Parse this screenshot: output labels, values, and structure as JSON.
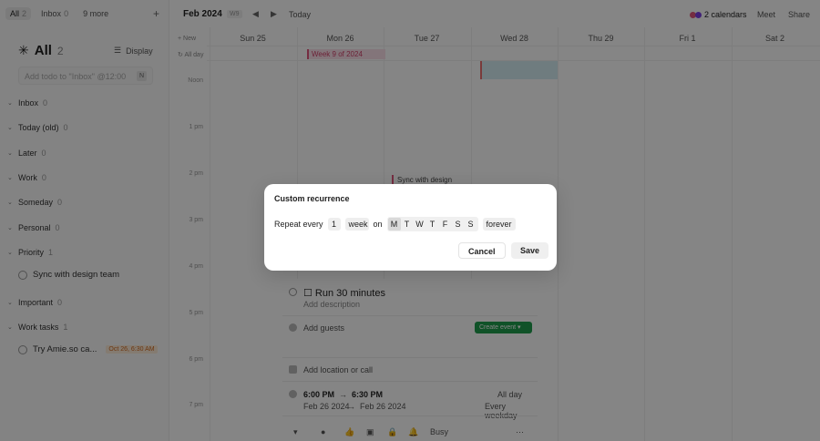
{
  "sidebar": {
    "tabs": [
      {
        "label": "All",
        "count": "2"
      },
      {
        "label": "Inbox",
        "count": "0"
      },
      {
        "label": "9 more",
        "count": ""
      }
    ],
    "header": {
      "title": "All",
      "count": "2",
      "display_label": "Display"
    },
    "add_placeholder": "Add todo to \"Inbox\" @12:00",
    "add_shortcut": "N",
    "sections": [
      {
        "label": "Inbox",
        "count": "0"
      },
      {
        "label": "Today (old)",
        "count": "0"
      },
      {
        "label": "Later",
        "count": "0"
      },
      {
        "label": "Work",
        "count": "0"
      },
      {
        "label": "Someday",
        "count": "0"
      },
      {
        "label": "Personal",
        "count": "0"
      },
      {
        "label": "Priority",
        "count": "1"
      },
      {
        "label": "Important",
        "count": "0"
      },
      {
        "label": "Work tasks",
        "count": "1"
      }
    ],
    "todos": [
      {
        "label": "Sync with design team",
        "badge": ""
      },
      {
        "label": "Try Amie.so ca...",
        "badge": "Oct 26, 6:30 AM"
      }
    ]
  },
  "calendar": {
    "month": "Feb 2024",
    "week_badge": "W9",
    "today_label": "Today",
    "calendars_label": "2 calendars",
    "meet_label": "Meet",
    "share_label": "Share",
    "new_label": "New",
    "all_day_label": "All day",
    "days": [
      "Sun 25",
      "Mon 26",
      "Tue 27",
      "Wed 28",
      "Thu 29",
      "Fri 1",
      "Sat 2"
    ],
    "hours": [
      "Noon",
      "1 pm",
      "2 pm",
      "3 pm",
      "4 pm",
      "5 pm",
      "6 pm",
      "7 pm"
    ],
    "week_event": "Week 9 of 2024",
    "event_sync": "Sync with design",
    "colors": {
      "accent_pink": "#e0567d",
      "accent_purple": "#7b3fe4",
      "green": "#1f9d4c"
    }
  },
  "event_panel": {
    "title": "Run 30 minutes",
    "description": "Add description",
    "guests": "Add guests",
    "create_event": "Create event",
    "location": "Add location or call",
    "start_time": "6:00 PM",
    "end_time": "6:30 PM",
    "start_date": "Feb 26 2024",
    "end_date": "Feb 26 2024",
    "all_day": "All day",
    "repeat": "Every weekday",
    "busy": "Busy"
  },
  "modal": {
    "title": "Custom recurrence",
    "repeat_every": "Repeat every",
    "interval": "1",
    "unit": "week",
    "on": "on",
    "weekdays": [
      "M",
      "T",
      "W",
      "T",
      "F",
      "S",
      "S"
    ],
    "selected_day_index": 0,
    "end": "forever",
    "cancel": "Cancel",
    "save": "Save"
  }
}
